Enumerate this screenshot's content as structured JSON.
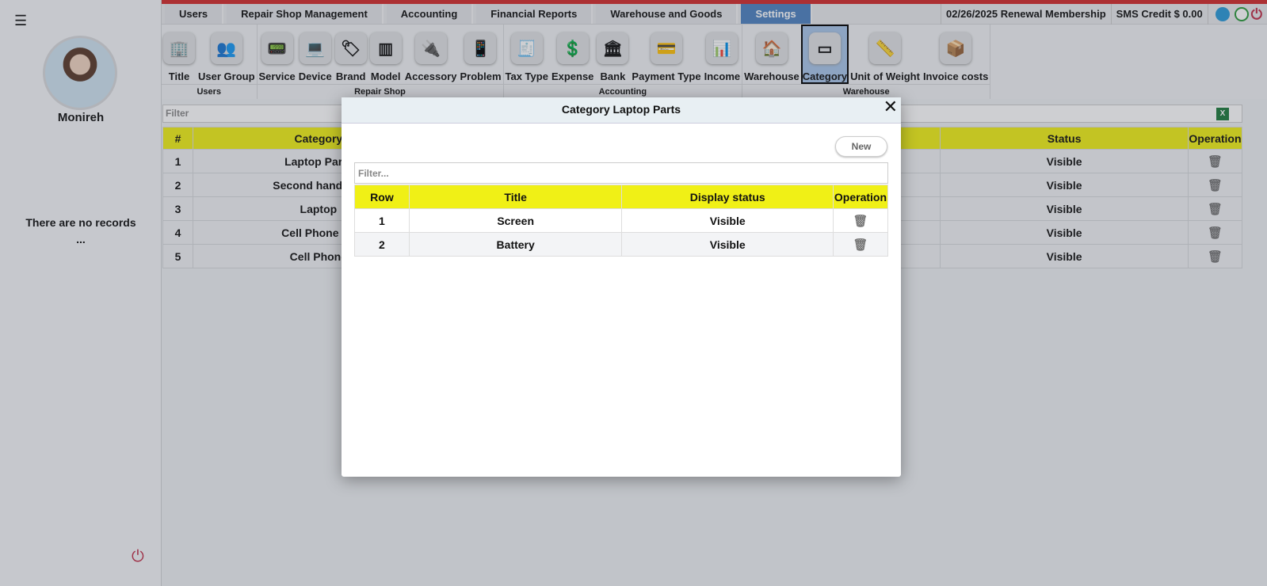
{
  "sidebar": {
    "user_name": "Monireh",
    "no_records": "There are no records",
    "ellipsis": "..."
  },
  "tabs": [
    "Users",
    "Repair Shop Management",
    "Accounting",
    "Financial Reports",
    "Warehouse and Goods",
    "Settings"
  ],
  "active_tab": "Settings",
  "topinfo": {
    "renewal": "02/26/2025 Renewal Membership",
    "sms": "SMS Credit $ 0.00"
  },
  "ribbon": [
    {
      "group": "Users",
      "items": [
        "Title",
        "User Group"
      ]
    },
    {
      "group": "Repair Shop",
      "items": [
        "Service",
        "Device",
        "Brand",
        "Model",
        "Accessory",
        "Problem"
      ]
    },
    {
      "group": "Accounting",
      "items": [
        "Tax Type",
        "Expense",
        "Bank",
        "Payment Type",
        "Income"
      ]
    },
    {
      "group": "Warehouse",
      "items": [
        "Warehouse",
        "Category",
        "Unit of Weight",
        "Invoice costs"
      ]
    }
  ],
  "selected_item": "Category",
  "main": {
    "filter_placeholder": "Filter",
    "headers": [
      "#",
      "Category",
      "",
      "Status",
      "Operation"
    ],
    "rows": [
      [
        "1",
        "Laptop Parts",
        "Visible"
      ],
      [
        "2",
        "Second hand cell",
        "Visible"
      ],
      [
        "3",
        "Laptop",
        "Visible"
      ],
      [
        "4",
        "Cell Phone Pa",
        "Visible"
      ],
      [
        "5",
        "Cell Phone",
        "Visible"
      ]
    ]
  },
  "modal": {
    "title": "Category Laptop Parts",
    "new_label": "New",
    "filter_placeholder": "Filter...",
    "headers": [
      "Row",
      "Title",
      "Display status",
      "Operation"
    ],
    "rows": [
      [
        "1",
        "Screen",
        "Visible"
      ],
      [
        "2",
        "Battery",
        "Visible"
      ]
    ]
  },
  "colors": {
    "accent": "#4e82c0",
    "header_yellow": "#f0f016",
    "topbar": "#d22b2b"
  }
}
